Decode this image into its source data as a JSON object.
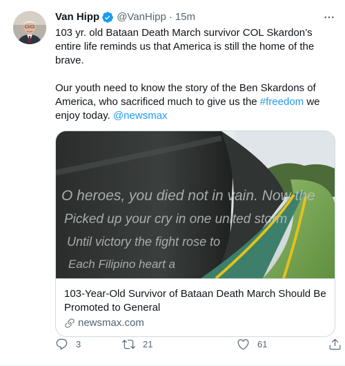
{
  "tweet": {
    "author_name": "Van Hipp",
    "handle": "@VanHipp",
    "separator": "·",
    "time": "15m",
    "paragraph1": "103 yr. old Bataan Death March survivor COL Skardon’s entire life reminds us that America is still the home of the brave.",
    "paragraph2_start": "Our youth need to know the story of the Ben Skardons of America, who sacrificed much to give us the ",
    "hashtag": "#freedom",
    "paragraph2_mid": " we enjoy today. ",
    "mention": "@newsmax"
  },
  "card": {
    "image_text": [
      "O heroes, you died not in vain. Now the",
      "Picked up your cry in one united storm",
      "Until victory the fight rose to",
      "Each Filipino heart a"
    ],
    "title": "103-Year-Old Survivor of Bataan Death March Should Be Promoted to General",
    "domain": "newsmax.com"
  },
  "actions": {
    "replies": "3",
    "retweets": "21",
    "likes": "61"
  },
  "colors": {
    "accent": "#1d9bf0",
    "text": "#0f1419",
    "secondary": "#536471",
    "border": "#cfd9de"
  }
}
